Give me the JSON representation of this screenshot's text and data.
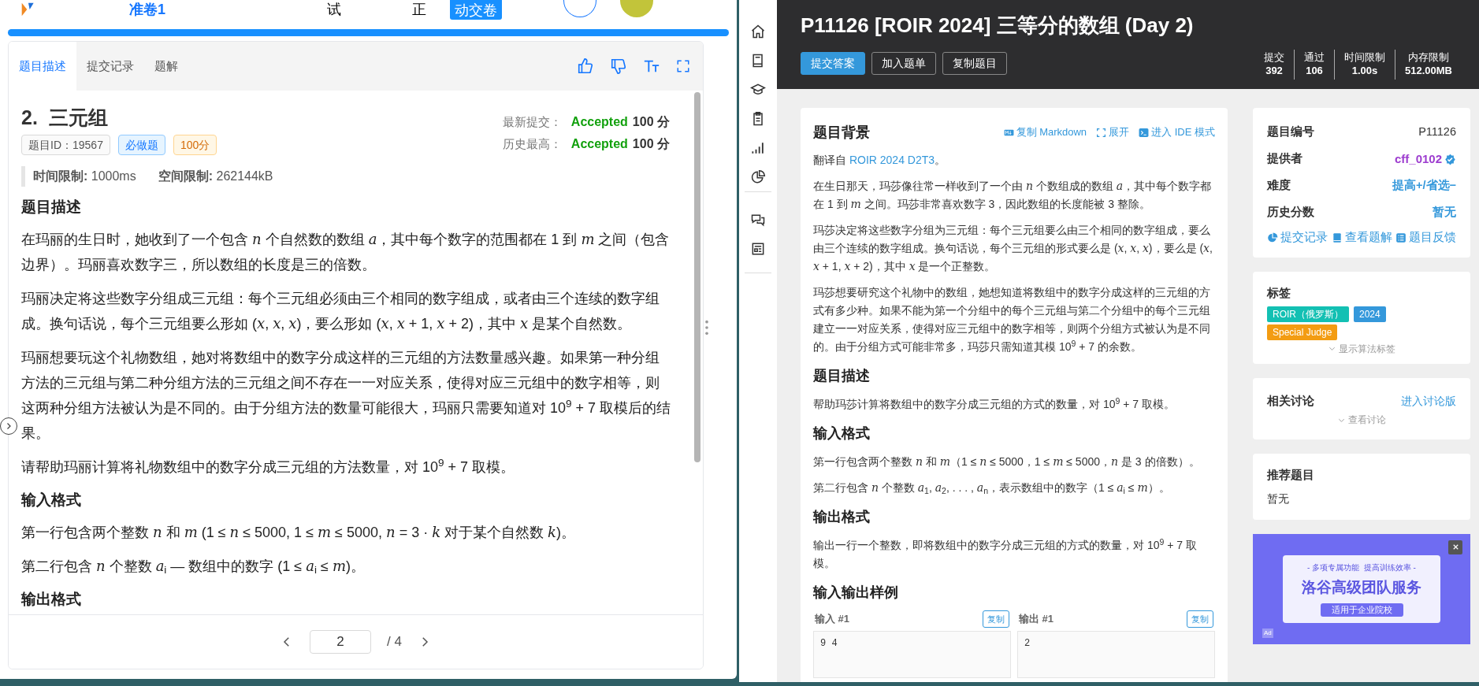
{
  "exam_header": {
    "title": "准卷1",
    "items": [
      "试",
      "正"
    ],
    "submit_button": "动交卷"
  },
  "progress": {
    "level": 1
  },
  "left_tabs": [
    {
      "label": "题目描述",
      "selected": true
    },
    {
      "label": "提交记录",
      "selected": false
    },
    {
      "label": "题解",
      "selected": false
    }
  ],
  "problem": {
    "title": "2.  三元组",
    "tags": [
      {
        "text": "题目ID：19567",
        "kind": "id"
      },
      {
        "text": "必做题",
        "kind": "required"
      },
      {
        "text": "100分",
        "kind": "score"
      }
    ],
    "results": [
      {
        "label": "最新提交：",
        "verdict": "Accepted",
        "score": "100 分"
      },
      {
        "label": "历史最高：",
        "verdict": "Accepted",
        "score": "100 分"
      }
    ],
    "limits": [
      {
        "label": "时间限制:",
        "value": "1000ms"
      },
      {
        "label": "空间限制:",
        "value": "262144kB"
      }
    ],
    "sections": [
      {
        "heading": "题目描述",
        "paragraphs": [
          "在玛丽的生日时，她收到了一个包含 *n* 个自然数的数组 *a*，其中每个数字的范围都在 1 到 *m* 之间（包含边界）。玛丽喜欢数字三，所以数组的长度是三的倍数。",
          "玛丽决定将这些数字分组成三元组：每个三元组必须由三个相同的数字组成，或者由三个连续的数字组成。换句话说，每个三元组要么形如 (*x*, *x*, *x*)，要么形如 (*x*, *x* + 1, *x* + 2)，其中 *x* 是某个自然数。",
          "玛丽想要玩这个礼物数组，她对将数组中的数字分成这样的三元组的方法数量感兴趣。如果第一种分组方法的三元组与第二种分组方法的三元组之间不存在一一对应关系，使得对应三元组中的数字相等，则这两种分组方法被认为是不同的。由于分组方法的数量可能很大，玛丽只需要知道对 10$^{9}$ + 7 取模后的结果。",
          "请帮助玛丽计算将礼物数组中的数字分成三元组的方法数量，对 10$^{9}$ + 7 取模。"
        ]
      },
      {
        "heading": "输入格式",
        "paragraphs": [
          "第一行包含两个整数 *n* 和 *m* (1 ≤ *n* ≤ 5000, 1 ≤ *m* ≤ 5000, *n* = 3 · *k* 对于某个自然数 *k*)。",
          "第二行包含 *n* 个整数 *a*$_{i}$ — 数组中的数字 (1 ≤ *a*$_{i}$ ≤ *m*)。"
        ]
      },
      {
        "heading": "输出格式"
      }
    ]
  },
  "pagination": {
    "page": "2",
    "total": "/ 4"
  },
  "luogu": {
    "title": "P11126 [ROIR 2024] 三等分的数组 (Day 2)",
    "buttons": [
      {
        "label": "提交答案",
        "kind": "primary"
      },
      {
        "label": "加入题单",
        "kind": "outline"
      },
      {
        "label": "复制题目",
        "kind": "outline"
      }
    ],
    "stats": [
      {
        "label": "提交",
        "value": "392"
      },
      {
        "label": "通过",
        "value": "106"
      },
      {
        "label": "时间限制",
        "value": "1.00s"
      },
      {
        "label": "内存限制",
        "value": "512.00MB"
      }
    ],
    "actions": [
      {
        "label": "复制 Markdown",
        "kind": "markdown"
      },
      {
        "label": "展开",
        "kind": "expand"
      },
      {
        "label": "进入 IDE 模式",
        "kind": "terminal"
      }
    ],
    "source": {
      "prefix": "翻译自 ",
      "link": "ROIR 2024 D2T3",
      "suffix": "。"
    },
    "sections": [
      {
        "heading": "题目背景",
        "paragraphs": [
          "在生日那天，玛莎像往常一样收到了一个由 *n* 个数组成的数组 *a*，其中每个数字都在 1 到 *m* 之间。玛莎非常喜欢数字 3，因此数组的长度能被 3 整除。",
          "玛莎决定将这些数字分组为三元组：每个三元组要么由三个相同的数字组成，要么由三个连续的数字组成。换句话说，每个三元组的形式要么是 (*x*, *x*, *x*)，要么是 (*x*, *x* + 1, *x* + 2)，其中 *x* 是一个正整数。",
          "玛莎想要研究这个礼物中的数组，她想知道将数组中的数字分成这样的三元组的方式有多少种。如果不能为第一个分组中的每个三元组与第二个分组中的每个三元组建立一一对应关系，使得对应三元组中的数字相等，则两个分组方式被认为是不同的。由于分组方式可能非常多，玛莎只需知道其模 10$^{9}$ + 7 的余数。"
        ]
      },
      {
        "heading": "题目描述",
        "paragraphs": [
          "帮助玛莎计算将数组中的数字分成三元组的方式的数量，对 10$^{9}$ + 7 取模。"
        ]
      },
      {
        "heading": "输入格式",
        "paragraphs": [
          "第一行包含两个整数 *n* 和 *m*（1 ≤ *n* ≤ 5000，1 ≤ *m* ≤ 5000，*n* 是 3 的倍数）。",
          "第二行包含 *n* 个整数 *a*$_{1}$, *a*$_{2}$, . . . , *a*$_{n}$，表示数组中的数字（1 ≤ *a*$_{i}$ ≤ *m*）。"
        ]
      },
      {
        "heading": "输出格式",
        "paragraphs": [
          "输出一行一个整数，即将数组中的数字分成三元组的方式的数量，对 10$^{9}$ + 7 取模。"
        ]
      }
    ],
    "samples": {
      "heading": "输入输出样例",
      "items": [
        {
          "label": "输入 #1",
          "copy": "复制",
          "lines": [
            "9 4"
          ]
        },
        {
          "label": "输出 #1",
          "copy": "复制",
          "lines": [
            "2"
          ]
        }
      ]
    }
  },
  "info": {
    "rows": [
      {
        "label": "题目编号",
        "value": "P11126",
        "kind": "plain"
      },
      {
        "label": "提供者",
        "value": "cff_0102",
        "kind": "user"
      },
      {
        "label": "难度",
        "value": "提高+/省选−",
        "kind": "link"
      },
      {
        "label": "历史分数",
        "value": "暂无",
        "kind": "link"
      }
    ],
    "links": [
      {
        "label": "提交记录",
        "kind": "pie"
      },
      {
        "label": "查看题解",
        "kind": "book"
      },
      {
        "label": "题目反馈",
        "kind": "list"
      }
    ]
  },
  "tags_card": {
    "title": "标签",
    "tags": [
      {
        "text": "ROIR（俄罗斯）",
        "color": "#13c0b3"
      },
      {
        "text": "2024",
        "color": "#3498db"
      },
      {
        "text": "Special Judge",
        "color": "#f39c12"
      }
    ],
    "toggle": "显示算法标签"
  },
  "discussion": {
    "title": "相关讨论",
    "link": "进入讨论版",
    "toggle": "查看讨论"
  },
  "recommended": {
    "title": "推荐题目",
    "value": "暂无"
  },
  "ad": {
    "subtitle": "- 多项专属功能  提高训练效率 -",
    "title": "洛谷高级团队服务",
    "button": "适用于企业院校",
    "badge": "Ad"
  }
}
